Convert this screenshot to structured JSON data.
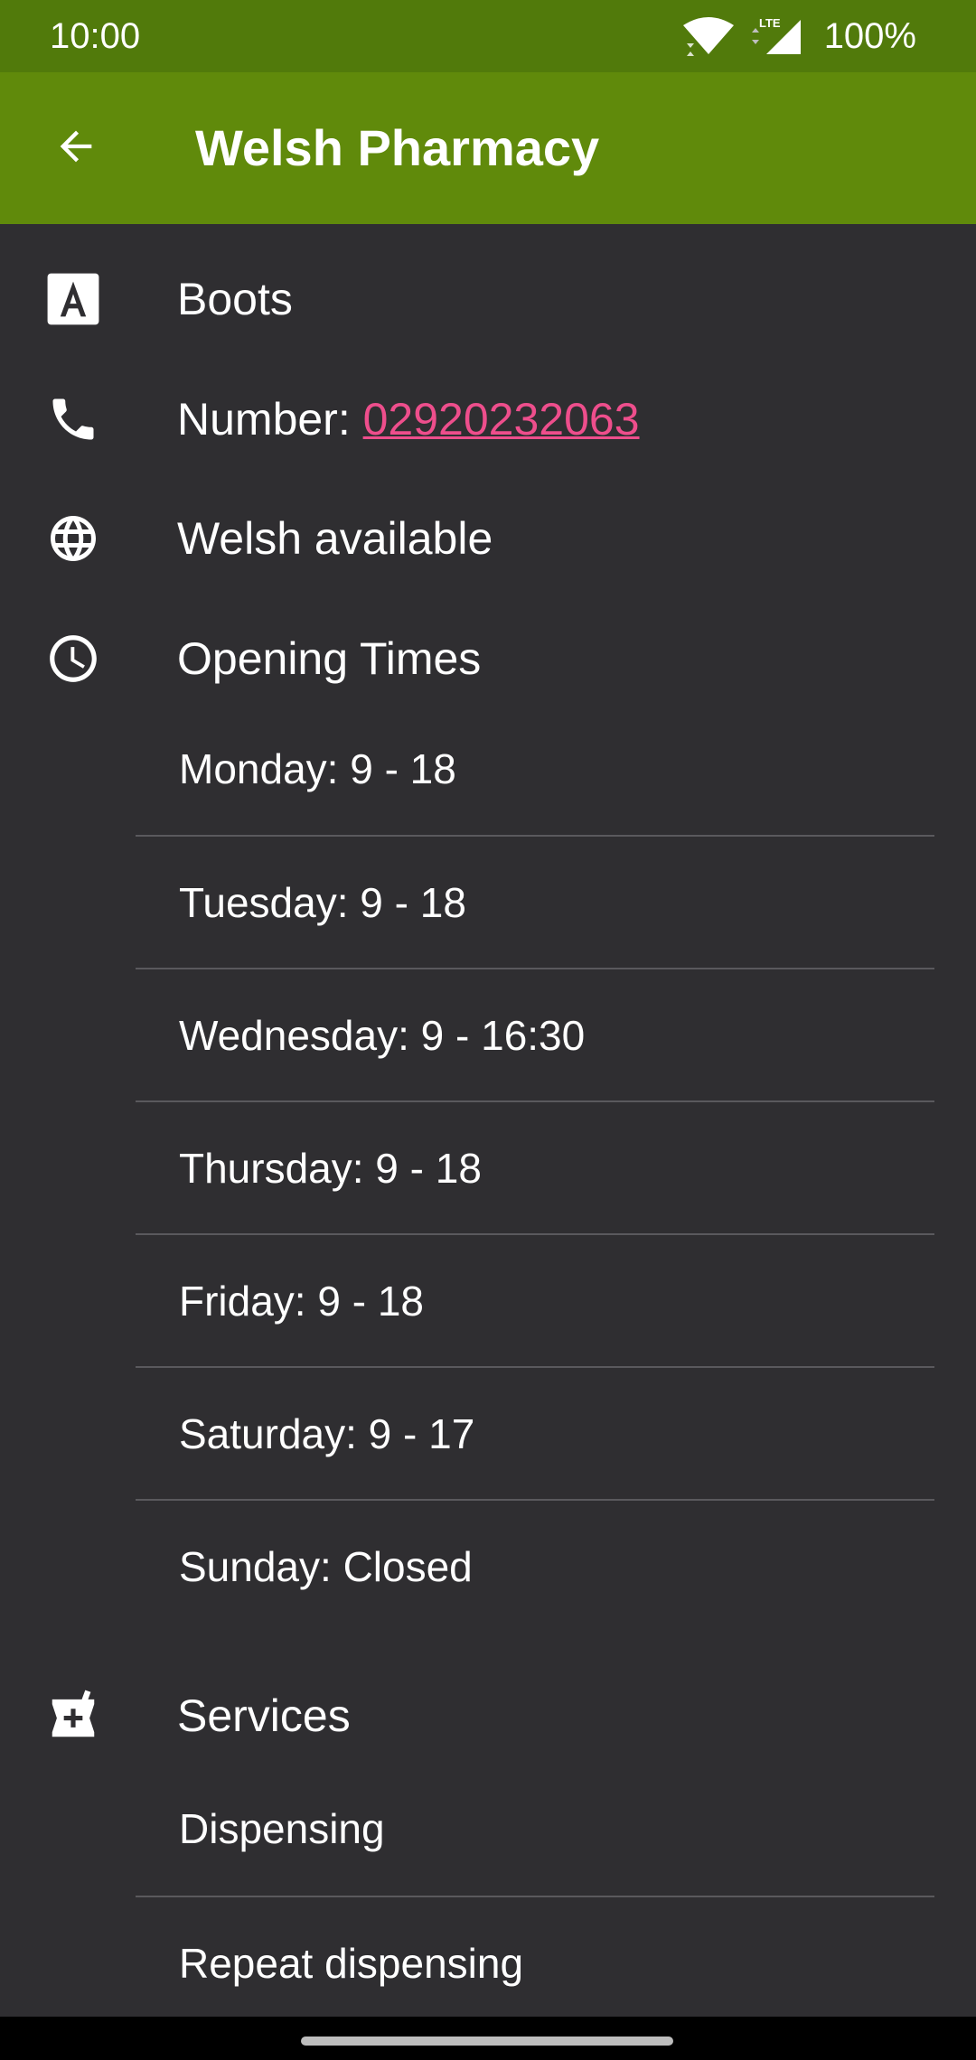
{
  "status_bar": {
    "time": "10:00",
    "network": "LTE",
    "battery": "100%"
  },
  "app_bar": {
    "title": "Welsh Pharmacy",
    "back_icon": "arrow-back-icon"
  },
  "details": {
    "name": "Boots",
    "number_label": "Number: ",
    "number": "02920232063",
    "language": "Welsh available",
    "opening_times_heading": "Opening Times",
    "opening_times": [
      "Monday: 9 - 18",
      "Tuesday: 9 - 18",
      "Wednesday: 9 - 16:30",
      "Thursday: 9 - 18",
      "Friday: 9 - 18",
      "Saturday: 9 - 17",
      "Sunday: Closed"
    ],
    "services_heading": "Services",
    "services": [
      "Dispensing",
      "Repeat dispensing"
    ]
  },
  "colors": {
    "status_bar": "#517a0b",
    "app_bar": "#608a0b",
    "background": "#2f2e31",
    "link": "#ee4e8c",
    "divider": "#5a595d"
  },
  "icons": {
    "name": "font-letter-a-icon",
    "phone": "phone-icon",
    "language": "globe-icon",
    "opening_times": "clock-icon",
    "services": "pharmacy-icon"
  }
}
